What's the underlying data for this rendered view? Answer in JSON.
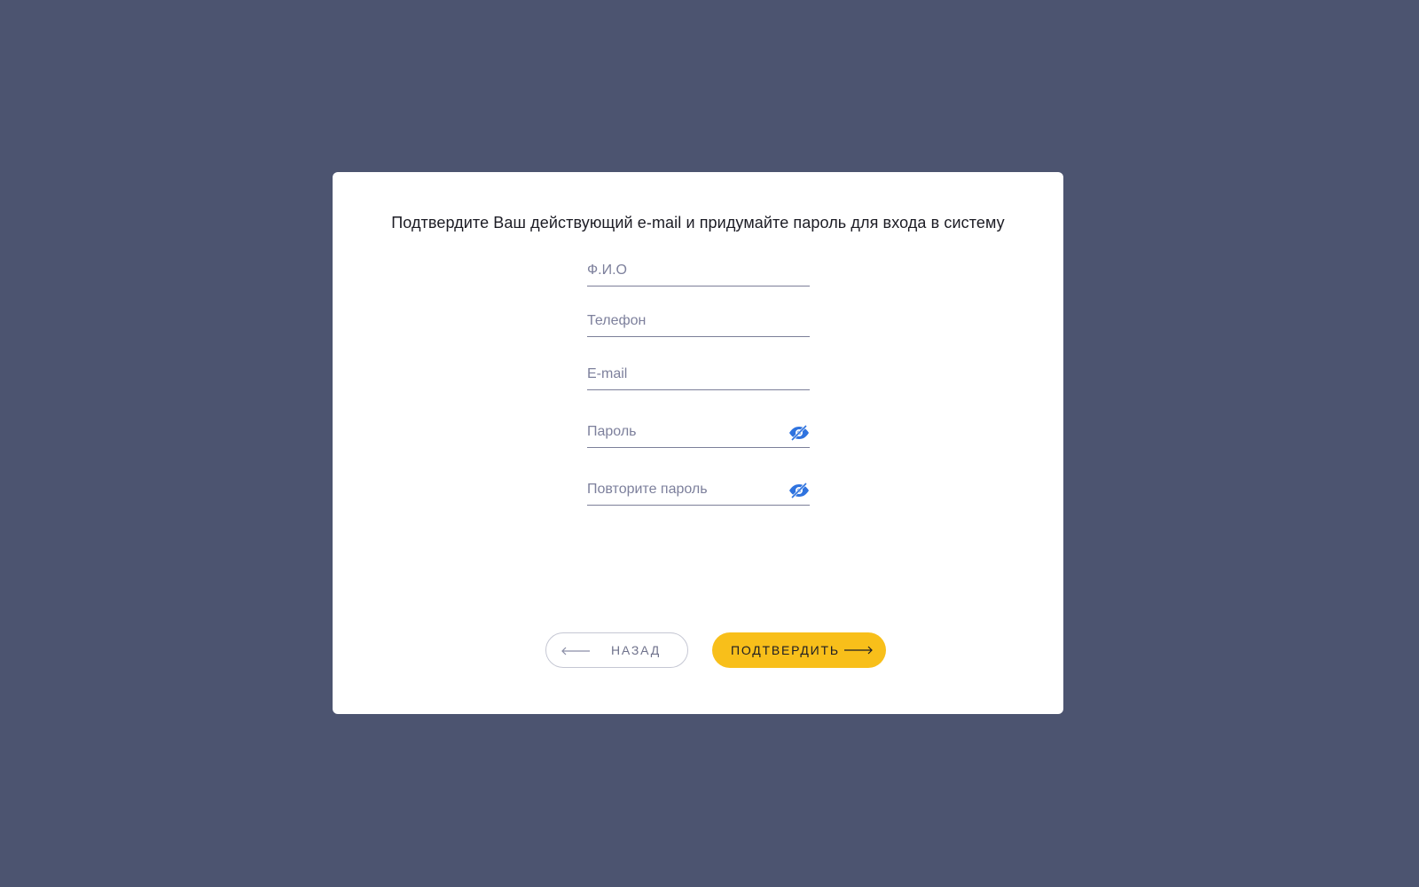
{
  "form": {
    "title": "Подтвердите Ваш действующий e-mail и придумайте пароль для входа в систему",
    "fields": {
      "full_name": {
        "placeholder": "Ф.И.О",
        "value": ""
      },
      "phone": {
        "placeholder": "Телефон",
        "value": ""
      },
      "email": {
        "placeholder": "E-mail",
        "value": ""
      },
      "password": {
        "placeholder": "Пароль",
        "value": "",
        "icon": "eye-off-icon"
      },
      "password_repeat": {
        "placeholder": "Повторите пароль",
        "value": "",
        "icon": "eye-off-icon"
      }
    },
    "buttons": {
      "back_label": "НАЗАД",
      "confirm_label": "ПОДТВЕРДИТЬ"
    }
  },
  "colors": {
    "background": "#4c5470",
    "card": "#ffffff",
    "accent_button": "#f8bf1a",
    "eye_icon": "#2f73df",
    "underline": "#7c7f99"
  }
}
